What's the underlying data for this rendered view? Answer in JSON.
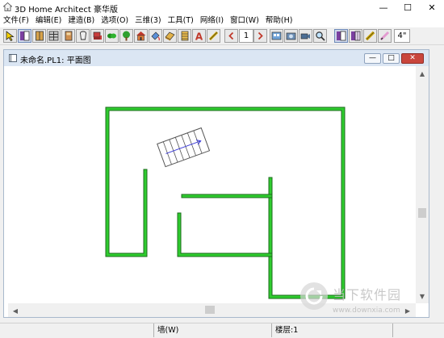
{
  "app": {
    "title": "3D Home Architect 豪华版",
    "controls": [
      "—",
      "☐",
      "✕"
    ]
  },
  "menu": [
    "文件(F)",
    "编辑(E)",
    "建造(B)",
    "选项(O)",
    "三维(3)",
    "工具(T)",
    "网络(I)",
    "窗口(W)",
    "帮助(H)"
  ],
  "toolbar": {
    "floor_number": "1",
    "grid_size": "4\"",
    "icons": [
      "select-arrow-icon",
      "door-icon",
      "window-icon",
      "cabinet-icon",
      "fixture-icon",
      "appliance-icon",
      "furniture-icon",
      "plant-icon",
      "tree-icon",
      "house-icon",
      "paint-icon",
      "material-icon",
      "stair-icon",
      "text-icon",
      "dimension-icon",
      "floor-down-icon",
      "floor-up-icon",
      "plan-view-icon",
      "full-camera-icon",
      "camera-icon",
      "zoom-icon",
      "door-view-icon",
      "window-view-icon",
      "ruler-icon",
      "pencil-icon"
    ]
  },
  "document": {
    "title": "未命名.PL1: 平面图",
    "controls": [
      "—",
      "□",
      "✕"
    ]
  },
  "plan": {
    "wall_color": "#2ecc2e",
    "wall_outline": "#1e6b1e",
    "stair_color": "#555555",
    "arrow_color": "#3a3ad8"
  },
  "status": {
    "tool": "墙(W)",
    "floor": "楼层:1"
  },
  "watermark": {
    "name": "当下软件园",
    "url": "www.downxia.com"
  }
}
